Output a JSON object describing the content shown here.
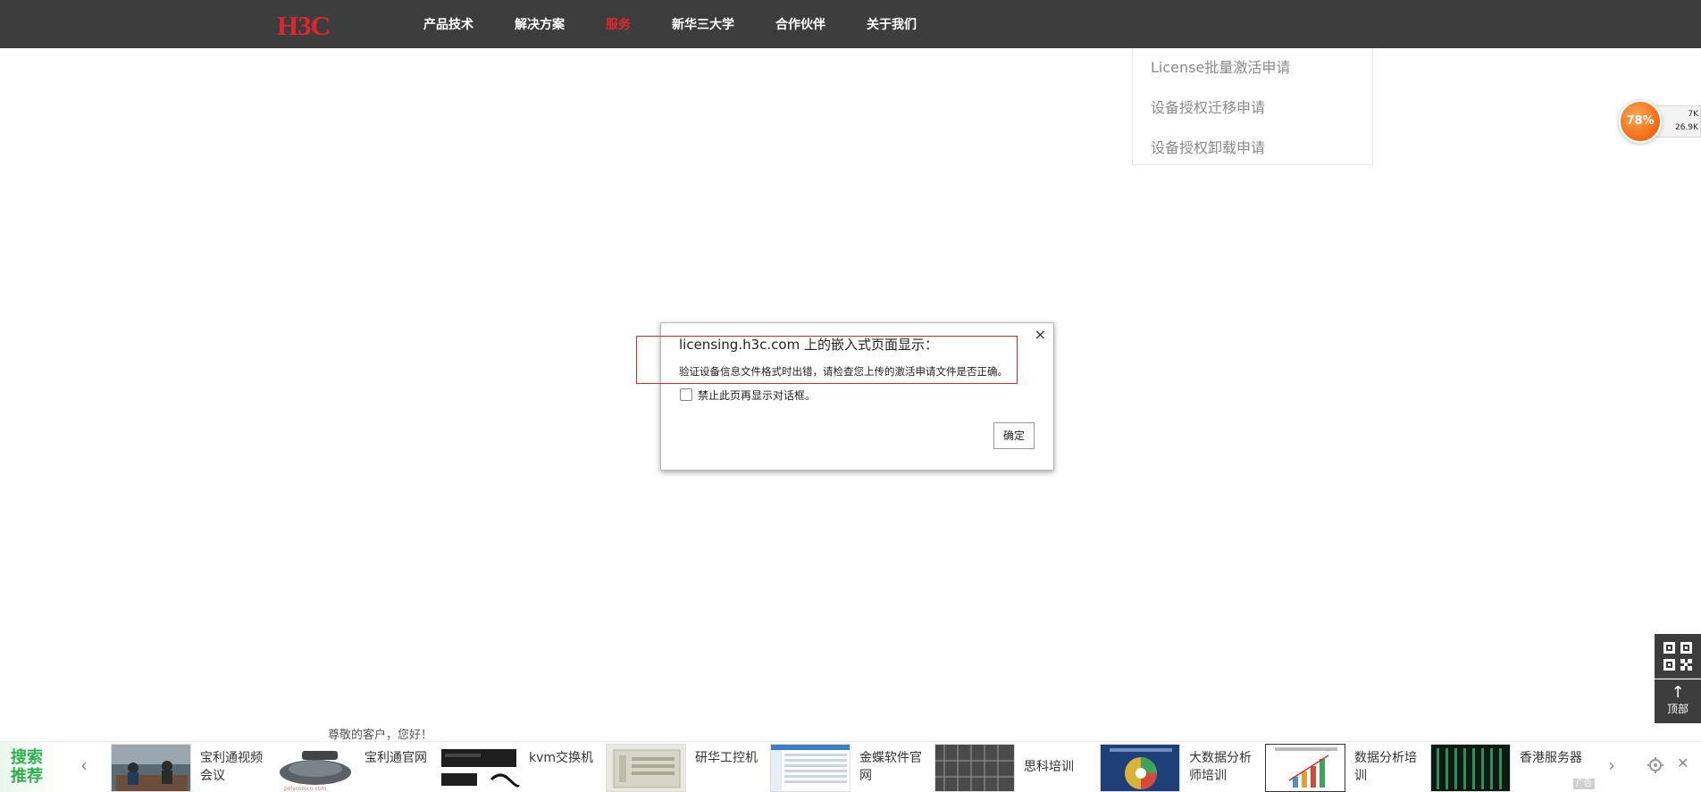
{
  "header": {
    "logo_text": "H3C",
    "nav": [
      {
        "label": "产品技术",
        "active": false
      },
      {
        "label": "解决方案",
        "active": false
      },
      {
        "label": "服务",
        "active": true
      },
      {
        "label": "新华三大学",
        "active": false
      },
      {
        "label": "合作伙伴",
        "active": false
      },
      {
        "label": "关于我们",
        "active": false
      }
    ]
  },
  "service_menu": {
    "items": [
      "License批量激活申请",
      "设备授权迁移申请",
      "设备授权卸载申请"
    ]
  },
  "speed_widget": {
    "percent_label": "78%",
    "upload": "7K",
    "download": "26.9K"
  },
  "dialog": {
    "title": "licensing.h3c.com 上的嵌入式页面显示：",
    "message": "验证设备信息文件格式时出错，请检查您上传的激活申请文件是否正确。",
    "checkbox_label": "禁止此页再显示对话框。",
    "ok_label": "确定",
    "close_glyph": "×"
  },
  "side_tools": {
    "top_label": "顶部"
  },
  "greeting": "尊敬的客户，您好！",
  "ad_bar": {
    "tag": "搜索推荐",
    "badge": "广告",
    "items": [
      {
        "label": "宝利通视频会议"
      },
      {
        "label": "宝利通官网"
      },
      {
        "label": "kvm交换机"
      },
      {
        "label": "研华工控机"
      },
      {
        "label": "金蝶软件官网"
      },
      {
        "label": "思科培训"
      },
      {
        "label": "大数据分析师培训"
      },
      {
        "label": "数据分析培训"
      },
      {
        "label": "香港服务器"
      }
    ]
  },
  "colors": {
    "nav_bg": "#3d3d3d",
    "accent_red": "#e0262d",
    "search_green": "#2eb04e",
    "speed_orange": "#f06a12"
  }
}
